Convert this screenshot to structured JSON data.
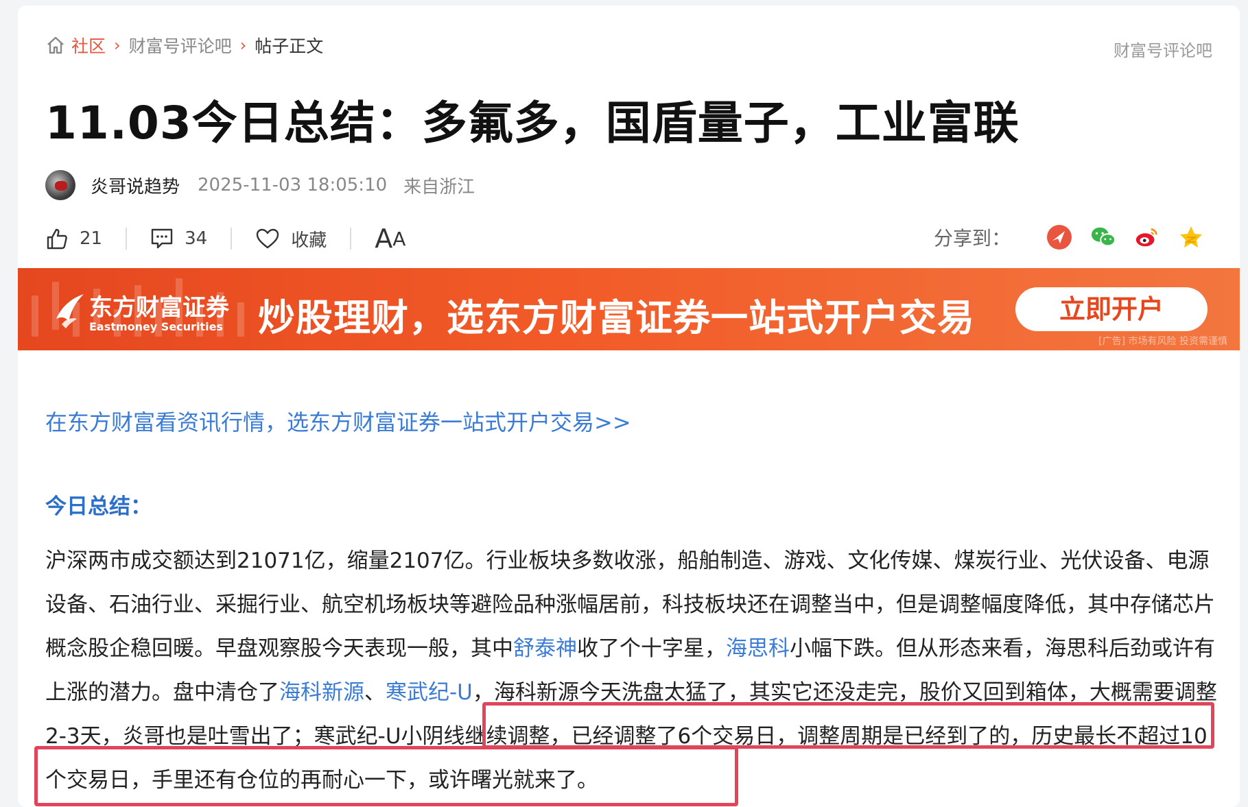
{
  "breadcrumb": {
    "home": "社区",
    "bar": "财富号评论吧",
    "current": "帖子正文",
    "right_link": "财富号评论吧"
  },
  "post": {
    "title": "11.03今日总结：多氟多，国盾量子，工业富联",
    "author": "炎哥说趋势",
    "time": "2025-11-03 18:05:10",
    "location": "来自浙江"
  },
  "actions": {
    "likes": "21",
    "comments": "34",
    "favorite_label": "收藏",
    "font_big": "A",
    "font_small": "A"
  },
  "share": {
    "label": "分享到：",
    "icons": [
      "toutiao-icon",
      "wechat-icon",
      "weibo-icon",
      "qzone-icon"
    ]
  },
  "banner": {
    "brand_cn": "东方财富证券",
    "brand_en": "Eastmoney Securities",
    "slogan": "炒股理财，选东方财富证券一站式开户交易",
    "cta": "立即开户",
    "note": "[广告] 市场有风险 投资需谨慎"
  },
  "promo_link": "在东方财富看资讯行情，选东方财富证券一站式开户交易>>",
  "section_title": "今日总结：",
  "body": {
    "p1": "沪深两市成交额达到21071亿，缩量2107亿。行业板块多数收涨，船舶制造、游戏、文化传媒、煤炭行业、光伏设备、电源设备、石油行业、采掘行业、航空机场板块等避险品种涨幅居前，科技板块还在调整当中，但是调整幅度降低，其中存储芯片概念股企稳回暖。早盘观察股今天表现一般，其中",
    "link1": "舒泰神",
    "p2": "收了个十字星，",
    "link2": "海思科",
    "p3": "小幅下跌。但从形态来看，海思科后劲或许有上涨的潜力。盘中清仓了",
    "link3": "海科新源",
    "p4": "、",
    "link4": "寒武纪-U",
    "p5": "，海科新源今天洗盘太猛了，其实它还没走完，股价又回到箱体，大概需要调整2-3天，炎哥也是吐雪出了；",
    "p6": "寒武纪-U小阴线继续调整，已经调整了6个交易日，调整周期是已经到了的，历史最长不超过10个交易日，手里还有仓位的再耐心一下，或许曙光就来了。"
  },
  "colors": {
    "accent": "#e8553e",
    "link": "#3a7bd5",
    "highlight_box": "#e0465b",
    "banner": "#f25b28"
  }
}
